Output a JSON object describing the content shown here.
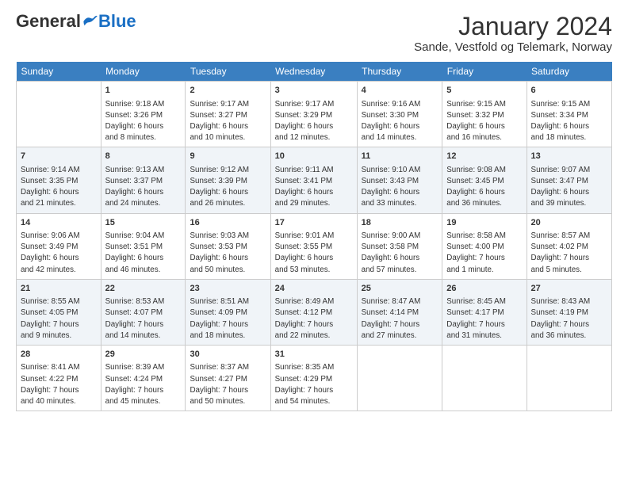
{
  "logo": {
    "general": "General",
    "blue": "Blue"
  },
  "title": "January 2024",
  "subtitle": "Sande, Vestfold og Telemark, Norway",
  "days_header": [
    "Sunday",
    "Monday",
    "Tuesday",
    "Wednesday",
    "Thursday",
    "Friday",
    "Saturday"
  ],
  "weeks": [
    [
      {
        "day": "",
        "info": ""
      },
      {
        "day": "1",
        "info": "Sunrise: 9:18 AM\nSunset: 3:26 PM\nDaylight: 6 hours\nand 8 minutes."
      },
      {
        "day": "2",
        "info": "Sunrise: 9:17 AM\nSunset: 3:27 PM\nDaylight: 6 hours\nand 10 minutes."
      },
      {
        "day": "3",
        "info": "Sunrise: 9:17 AM\nSunset: 3:29 PM\nDaylight: 6 hours\nand 12 minutes."
      },
      {
        "day": "4",
        "info": "Sunrise: 9:16 AM\nSunset: 3:30 PM\nDaylight: 6 hours\nand 14 minutes."
      },
      {
        "day": "5",
        "info": "Sunrise: 9:15 AM\nSunset: 3:32 PM\nDaylight: 6 hours\nand 16 minutes."
      },
      {
        "day": "6",
        "info": "Sunrise: 9:15 AM\nSunset: 3:34 PM\nDaylight: 6 hours\nand 18 minutes."
      }
    ],
    [
      {
        "day": "7",
        "info": "Sunrise: 9:14 AM\nSunset: 3:35 PM\nDaylight: 6 hours\nand 21 minutes."
      },
      {
        "day": "8",
        "info": "Sunrise: 9:13 AM\nSunset: 3:37 PM\nDaylight: 6 hours\nand 24 minutes."
      },
      {
        "day": "9",
        "info": "Sunrise: 9:12 AM\nSunset: 3:39 PM\nDaylight: 6 hours\nand 26 minutes."
      },
      {
        "day": "10",
        "info": "Sunrise: 9:11 AM\nSunset: 3:41 PM\nDaylight: 6 hours\nand 29 minutes."
      },
      {
        "day": "11",
        "info": "Sunrise: 9:10 AM\nSunset: 3:43 PM\nDaylight: 6 hours\nand 33 minutes."
      },
      {
        "day": "12",
        "info": "Sunrise: 9:08 AM\nSunset: 3:45 PM\nDaylight: 6 hours\nand 36 minutes."
      },
      {
        "day": "13",
        "info": "Sunrise: 9:07 AM\nSunset: 3:47 PM\nDaylight: 6 hours\nand 39 minutes."
      }
    ],
    [
      {
        "day": "14",
        "info": "Sunrise: 9:06 AM\nSunset: 3:49 PM\nDaylight: 6 hours\nand 42 minutes."
      },
      {
        "day": "15",
        "info": "Sunrise: 9:04 AM\nSunset: 3:51 PM\nDaylight: 6 hours\nand 46 minutes."
      },
      {
        "day": "16",
        "info": "Sunrise: 9:03 AM\nSunset: 3:53 PM\nDaylight: 6 hours\nand 50 minutes."
      },
      {
        "day": "17",
        "info": "Sunrise: 9:01 AM\nSunset: 3:55 PM\nDaylight: 6 hours\nand 53 minutes."
      },
      {
        "day": "18",
        "info": "Sunrise: 9:00 AM\nSunset: 3:58 PM\nDaylight: 6 hours\nand 57 minutes."
      },
      {
        "day": "19",
        "info": "Sunrise: 8:58 AM\nSunset: 4:00 PM\nDaylight: 7 hours\nand 1 minute."
      },
      {
        "day": "20",
        "info": "Sunrise: 8:57 AM\nSunset: 4:02 PM\nDaylight: 7 hours\nand 5 minutes."
      }
    ],
    [
      {
        "day": "21",
        "info": "Sunrise: 8:55 AM\nSunset: 4:05 PM\nDaylight: 7 hours\nand 9 minutes."
      },
      {
        "day": "22",
        "info": "Sunrise: 8:53 AM\nSunset: 4:07 PM\nDaylight: 7 hours\nand 14 minutes."
      },
      {
        "day": "23",
        "info": "Sunrise: 8:51 AM\nSunset: 4:09 PM\nDaylight: 7 hours\nand 18 minutes."
      },
      {
        "day": "24",
        "info": "Sunrise: 8:49 AM\nSunset: 4:12 PM\nDaylight: 7 hours\nand 22 minutes."
      },
      {
        "day": "25",
        "info": "Sunrise: 8:47 AM\nSunset: 4:14 PM\nDaylight: 7 hours\nand 27 minutes."
      },
      {
        "day": "26",
        "info": "Sunrise: 8:45 AM\nSunset: 4:17 PM\nDaylight: 7 hours\nand 31 minutes."
      },
      {
        "day": "27",
        "info": "Sunrise: 8:43 AM\nSunset: 4:19 PM\nDaylight: 7 hours\nand 36 minutes."
      }
    ],
    [
      {
        "day": "28",
        "info": "Sunrise: 8:41 AM\nSunset: 4:22 PM\nDaylight: 7 hours\nand 40 minutes."
      },
      {
        "day": "29",
        "info": "Sunrise: 8:39 AM\nSunset: 4:24 PM\nDaylight: 7 hours\nand 45 minutes."
      },
      {
        "day": "30",
        "info": "Sunrise: 8:37 AM\nSunset: 4:27 PM\nDaylight: 7 hours\nand 50 minutes."
      },
      {
        "day": "31",
        "info": "Sunrise: 8:35 AM\nSunset: 4:29 PM\nDaylight: 7 hours\nand 54 minutes."
      },
      {
        "day": "",
        "info": ""
      },
      {
        "day": "",
        "info": ""
      },
      {
        "day": "",
        "info": ""
      }
    ]
  ]
}
